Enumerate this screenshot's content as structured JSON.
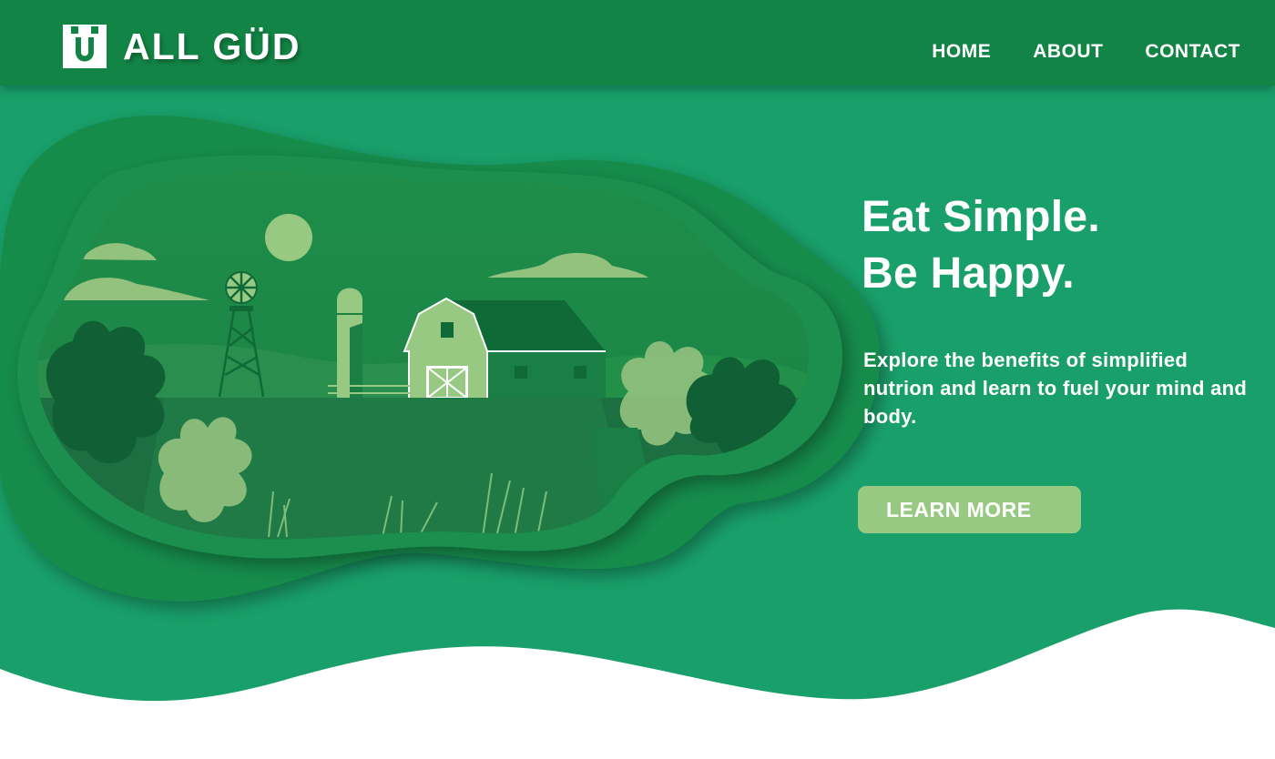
{
  "brand": {
    "name": "ALL GÜD",
    "logo_icon": "u-smile-logo-mark"
  },
  "nav": {
    "home": "HOME",
    "about": "ABOUT",
    "contact": "CONTACT"
  },
  "hero": {
    "headline_line1": "Eat Simple.",
    "headline_line2": "Be Happy.",
    "subtext": "Explore the benefits of simplified nutrion and learn to fuel your mind and body.",
    "cta_label": "LEARN MORE"
  },
  "colors": {
    "header": "#128445",
    "background": "#19a06a",
    "button": "#98c982",
    "text": "#ffffff"
  }
}
